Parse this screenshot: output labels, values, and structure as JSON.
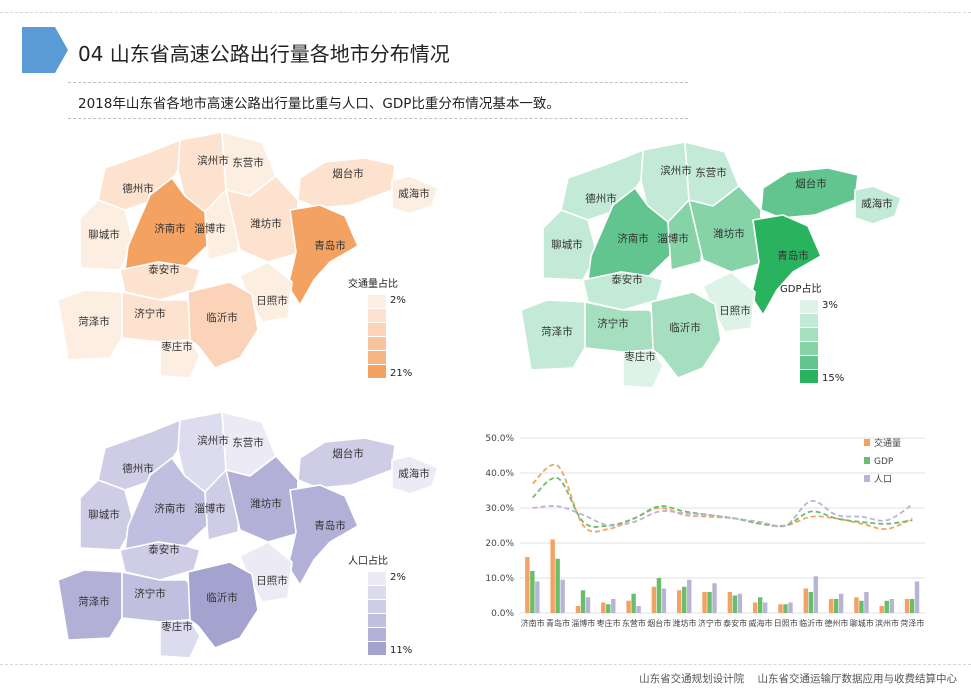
{
  "header": {
    "title": "04  山东省高速公路出行量各地市分布情况",
    "subtitle": "2018年山东省各地市高速公路出行量比重与人口、GDP比重分布情况基本一致。"
  },
  "footer": {
    "org1": "山东省交通规划设计院",
    "org2": "山东省交通运输厅数据应用与收费结算中心"
  },
  "cities": [
    "滨州市",
    "东营市",
    "德州市",
    "烟台市",
    "威海市",
    "聊城市",
    "济南市",
    "淄博市",
    "潍坊市",
    "青岛市",
    "泰安市",
    "日照市",
    "菏泽市",
    "济宁市",
    "临沂市",
    "枣庄市"
  ],
  "maps": [
    {
      "legend_title": "交通量占比",
      "legend_min": "2%",
      "legend_max": "21%",
      "ramp": [
        "#fdeee2",
        "#fce2cf",
        "#fad3b8",
        "#f8c49f",
        "#f6b483",
        "#f3a262"
      ],
      "levels": {
        "滨州市": 1,
        "东营市": 0,
        "德州市": 1,
        "烟台市": 1,
        "威海市": 0,
        "聊城市": 0,
        "济南市": 5,
        "淄博市": 0,
        "潍坊市": 1,
        "青岛市": 5,
        "泰安市": 1,
        "日照市": 0,
        "菏泽市": 0,
        "济宁市": 1,
        "临沂市": 2,
        "枣庄市": 0
      }
    },
    {
      "legend_title": "GDP占比",
      "legend_min": "3%",
      "legend_max": "15%",
      "ramp": [
        "#def3e8",
        "#c3ead6",
        "#a6dfc0",
        "#86d3a8",
        "#62c58f",
        "#29b35f"
      ],
      "levels": {
        "滨州市": 1,
        "东营市": 1,
        "德州市": 1,
        "烟台市": 4,
        "威海市": 1,
        "聊城市": 1,
        "济南市": 4,
        "淄博市": 3,
        "潍坊市": 3,
        "青岛市": 5,
        "泰安市": 1,
        "日照市": 0,
        "菏泽市": 1,
        "济宁市": 2,
        "临沂市": 2,
        "枣庄市": 0
      }
    },
    {
      "legend_title": "人口占比",
      "legend_min": "2%",
      "legend_max": "11%",
      "ramp": [
        "#ecebf5",
        "#dddbee",
        "#cfcde6",
        "#c1bfdf",
        "#b2b0d6",
        "#a4a2ce"
      ],
      "levels": {
        "滨州市": 1,
        "东营市": 0,
        "德州市": 2,
        "烟台市": 2,
        "威海市": 0,
        "聊城市": 2,
        "济南市": 3,
        "淄博市": 2,
        "潍坊市": 4,
        "青岛市": 4,
        "泰安市": 2,
        "日照市": 0,
        "菏泽市": 4,
        "济宁市": 3,
        "临沂市": 5,
        "枣庄市": 1
      }
    }
  ],
  "chart_data": {
    "type": "bar",
    "categories": [
      "济南市",
      "青岛市",
      "淄博市",
      "枣庄市",
      "东营市",
      "烟台市",
      "潍坊市",
      "济宁市",
      "泰安市",
      "威海市",
      "日照市",
      "临沂市",
      "德州市",
      "聊城市",
      "滨州市",
      "菏泽市"
    ],
    "series": [
      {
        "name": "交通量",
        "color": "#f4a262",
        "values": [
          16,
          21,
          2,
          3,
          3.5,
          7.5,
          6.5,
          6,
          6,
          3,
          2.5,
          7,
          4,
          4.5,
          2,
          4
        ]
      },
      {
        "name": "GDP",
        "color": "#6bbd6b",
        "values": [
          12,
          15.5,
          6.5,
          2.5,
          5.5,
          10,
          7.5,
          6,
          5,
          4.5,
          2.5,
          6,
          4,
          3.5,
          3.5,
          4
        ]
      },
      {
        "name": "人口",
        "color": "#b8b4d6",
        "values": [
          9,
          9.5,
          4.5,
          4,
          2,
          7,
          9.5,
          8.5,
          5.5,
          3,
          3,
          10.5,
          5.5,
          6,
          4,
          9
        ]
      }
    ],
    "lines": [
      {
        "name": "交通量",
        "values": [
          37,
          42,
          25,
          24,
          27,
          30,
          28,
          27.5,
          27,
          25.5,
          25,
          27.5,
          27,
          25.5,
          24,
          27
        ]
      },
      {
        "name": "GDP",
        "values": [
          33,
          38.5,
          26,
          25,
          27,
          30.5,
          29,
          28,
          27,
          25.5,
          25,
          29,
          27,
          26,
          25.5,
          26.5
        ]
      },
      {
        "name": "人口",
        "values": [
          30,
          30.5,
          28,
          25,
          26,
          29,
          28.5,
          28,
          27,
          26,
          25,
          32,
          28,
          27.5,
          26.5,
          31
        ]
      }
    ],
    "ylim": [
      0,
      50
    ],
    "yticks": [
      "0.0%",
      "10.0%",
      "20.0%",
      "30.0%",
      "40.0%",
      "50.0%"
    ],
    "legend": [
      "交通量",
      "GDP",
      "人口"
    ],
    "legend_position": "top-right",
    "grid": true
  }
}
